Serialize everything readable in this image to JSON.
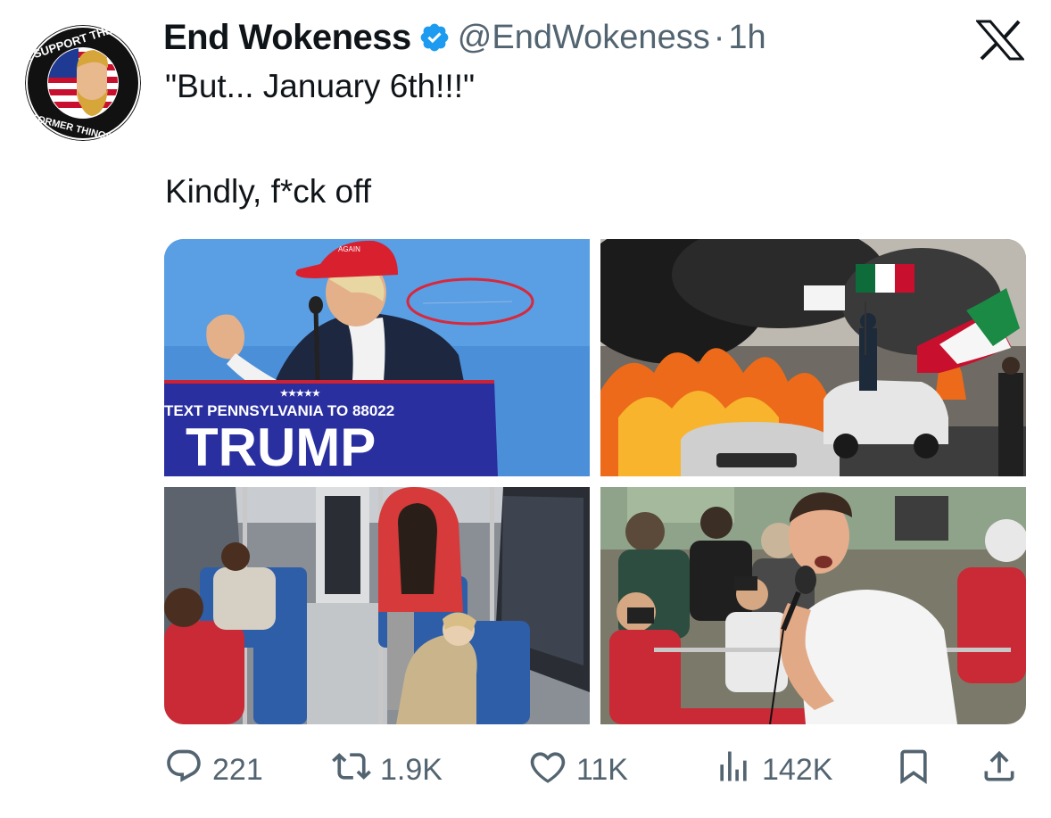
{
  "author": {
    "display_name": "End Wokeness",
    "handle": "@EndWokeness",
    "separator": "·",
    "time": "1h",
    "verified": true,
    "avatar_text_top": "I SUPPORT THE",
    "avatar_text_bottom": "FORMER THINGS"
  },
  "platform_logo": "x-logo",
  "tweet": {
    "line1": "\"But... January 6th!!!\"",
    "line2": "Kindly, f*ck off"
  },
  "media": {
    "photo1": {
      "cap_text": "AGAIN",
      "banner_small": "TEXT PENNSYLVANIA TO 88022",
      "banner_large": "TRUMP"
    }
  },
  "actions": {
    "replies": "221",
    "reposts": "1.9K",
    "likes": "11K",
    "views": "142K"
  },
  "icons": {
    "reply": "speech-bubble-icon",
    "repost": "repost-arrows-icon",
    "like": "heart-icon",
    "views": "bar-chart-icon",
    "bookmark": "bookmark-icon",
    "share": "share-upload-icon",
    "verified": "verified-badge-icon"
  },
  "colors": {
    "text": "#0f1419",
    "secondary": "#536471",
    "verified": "#1d9bf0"
  }
}
